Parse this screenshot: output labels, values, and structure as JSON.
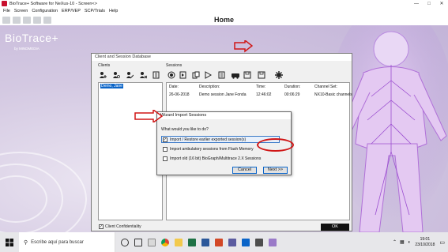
{
  "window": {
    "title": "BioTrace+ Software for NeXus-10 - Screen<>",
    "controls": [
      "—",
      "□",
      "✕"
    ]
  },
  "menu": [
    "File",
    "Screen",
    "Configuration",
    "ERP/VEP",
    "SCP/Trials",
    "Help"
  ],
  "toolbar": {
    "home_label": "Home"
  },
  "brand": {
    "name": "BioTrace+",
    "by": "by MINDMEDIA"
  },
  "db_window": {
    "title": "Client and Session Database",
    "clients_label": "Clients",
    "sessions_label": "Sessions",
    "client_selected": "Demo, Jane",
    "client_confidentiality": "Client Confidentiality",
    "ok_label": "OK",
    "table": {
      "headers": [
        "Date:",
        "Description:",
        "Time:",
        "Duration:",
        "Channel Set:"
      ],
      "rows": [
        [
          "26-06-2018",
          "Demo session Jane Fonda",
          "12:46:02",
          "00:06:29",
          "NX10-Basic channels"
        ]
      ]
    }
  },
  "wizard": {
    "title": "Wizard Import Sessions",
    "question": "What would you like to do?",
    "options": [
      {
        "label": "Import / Restore earlier exported session(s)",
        "checked": true
      },
      {
        "label": "Import ambulatory sessions from Flash Memory",
        "checked": false
      },
      {
        "label": "Import old (16 bit) BioGraph/Multitrace 2.X Sessions",
        "checked": false
      }
    ],
    "cancel_label": "Cancel",
    "next_label": "Next >>"
  },
  "taskbar": {
    "search_placeholder": "Escribe aquí para buscar",
    "time": "19:01",
    "date": "23/10/2018"
  },
  "colors": {
    "accent": "#0a64c8",
    "annotation": "#d01616",
    "app_bg": "#c9bddc"
  },
  "icons": [
    "search-icon",
    "windows-logo-icon",
    "cortana-icon",
    "task-view-icon",
    "chrome-icon",
    "explorer-icon",
    "word-icon",
    "excel-icon",
    "volume-icon",
    "network-icon",
    "notification-icon"
  ]
}
